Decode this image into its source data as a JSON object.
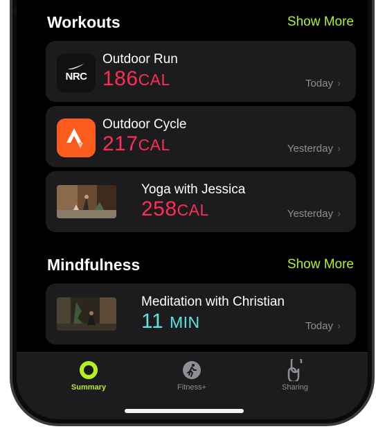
{
  "workouts": {
    "title": "Workouts",
    "show_more": "Show More",
    "items": [
      {
        "name": "Outdoor Run",
        "value": "186",
        "unit": "CAL",
        "when": "Today",
        "icon": "nrc-icon"
      },
      {
        "name": "Outdoor Cycle",
        "value": "217",
        "unit": "CAL",
        "when": "Yesterday",
        "icon": "strava-icon"
      },
      {
        "name": "Yoga with Jessica",
        "value": "258",
        "unit": "CAL",
        "when": "Yesterday",
        "icon": "yoga-thumbnail"
      }
    ]
  },
  "mindfulness": {
    "title": "Mindfulness",
    "show_more": "Show More",
    "items": [
      {
        "name": "Meditation with Christian",
        "value": "11",
        "unit": "MIN",
        "when": "Today",
        "icon": "meditation-thumbnail"
      }
    ]
  },
  "nrc_logo_text": "NRC",
  "tabbar": {
    "tabs": [
      {
        "label": "Summary",
        "icon": "activity-ring-icon",
        "active": true
      },
      {
        "label": "Fitness+",
        "icon": "runner-icon",
        "active": false
      },
      {
        "label": "Sharing",
        "icon": "sharing-icon",
        "active": false
      }
    ]
  },
  "colors": {
    "accent": "#b7f11d",
    "calories": "#ff2d55",
    "minutes": "#5ee3e0",
    "card": "#1c1c1e"
  }
}
